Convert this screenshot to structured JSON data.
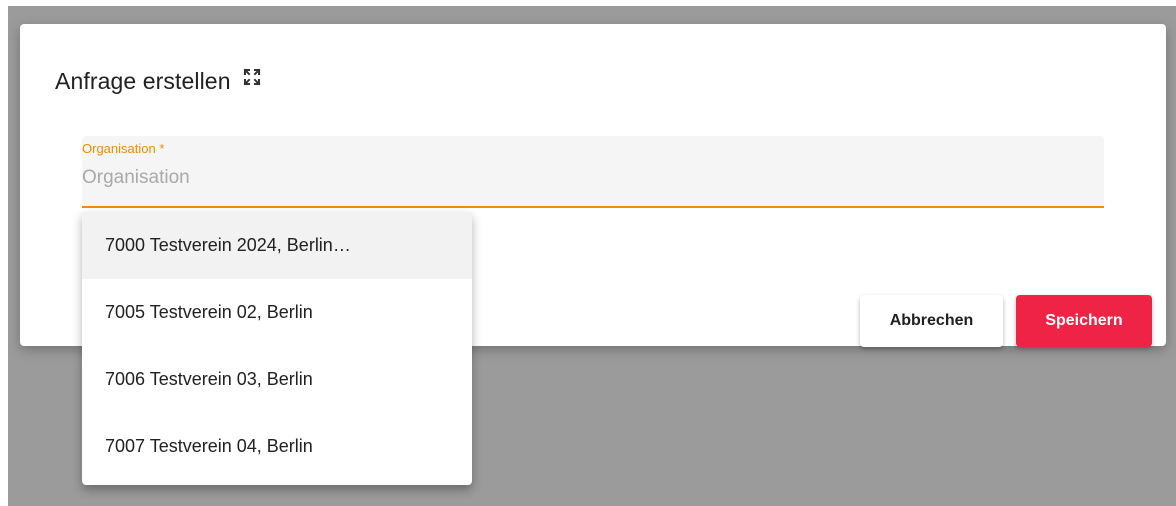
{
  "dialog": {
    "title": "Anfrage erstellen",
    "expand_icon": "expand-icon"
  },
  "organisation_field": {
    "label": "Organisation *",
    "placeholder": "Organisation",
    "value": "",
    "accent_color": "#f28c00"
  },
  "dropdown": {
    "options": [
      {
        "label": "7000 Testverein 2024, Berlin…",
        "highlighted": true
      },
      {
        "label": "7005 Testverein 02, Berlin",
        "highlighted": false
      },
      {
        "label": "7006 Testverein 03, Berlin",
        "highlighted": false
      },
      {
        "label": "7007 Testverein 04, Berlin",
        "highlighted": false
      }
    ]
  },
  "actions": {
    "cancel_label": "Abbrechen",
    "save_label": "Speichern",
    "save_color": "#ef2346"
  }
}
